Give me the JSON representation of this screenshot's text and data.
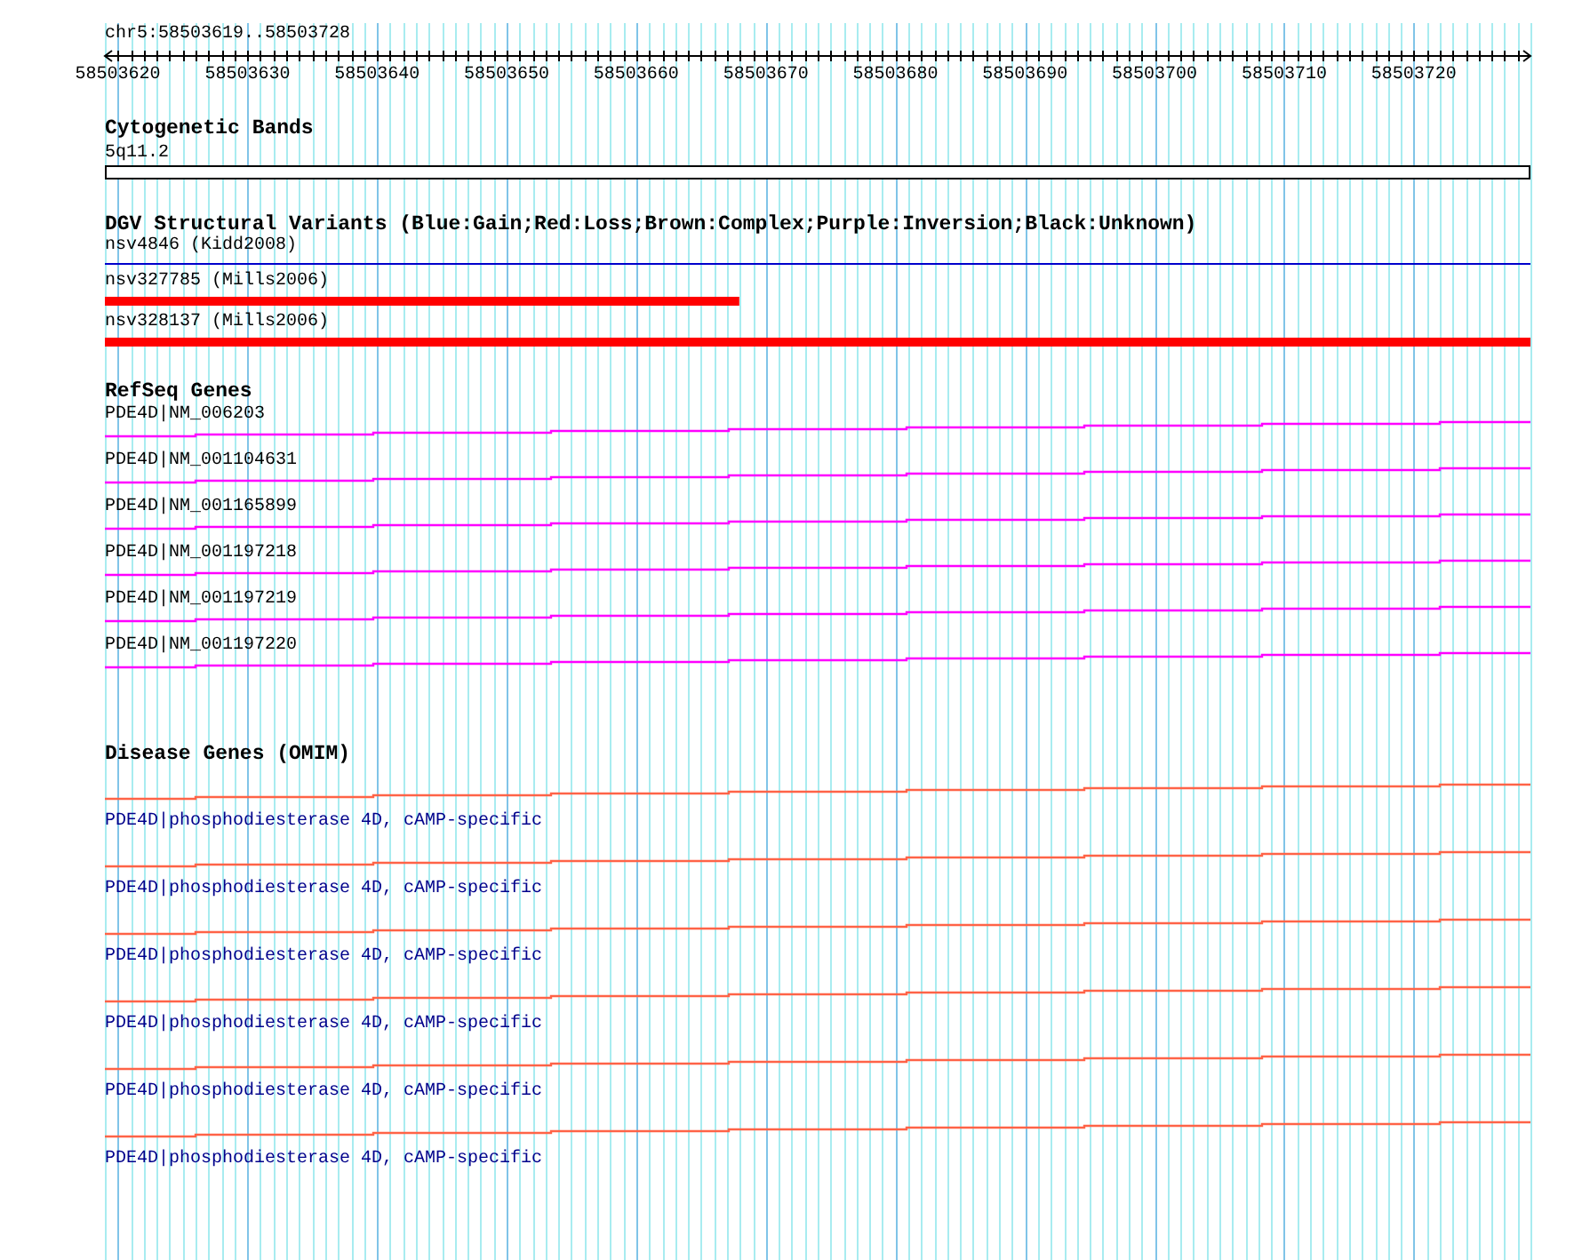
{
  "locus": "chr5:58503619..58503728",
  "ruler": {
    "ticks": [
      "58503620",
      "58503630",
      "58503640",
      "58503650",
      "58503660",
      "58503670",
      "58503680",
      "58503690",
      "58503700",
      "58503710",
      "58503720"
    ]
  },
  "tracks": [
    {
      "title": "Cytogenetic Bands",
      "kind": "bands",
      "features": [
        {
          "label": "5q11.2",
          "kind": "band"
        }
      ]
    },
    {
      "title": "DGV Structural Variants (Blue:Gain;Red:Loss;Brown:Complex;Purple:Inversion;Black:Unknown)",
      "kind": "variants",
      "features": [
        {
          "label": "nsv4846 (Kidd2008)",
          "kind": "line",
          "color": "#0000cc",
          "level": 1
        },
        {
          "label": "nsv327785 (Mills2006)",
          "kind": "bar",
          "color": "#ff0000",
          "level": 0.445
        },
        {
          "label": "nsv328137 (Mills2006)",
          "kind": "bar",
          "color": "#ff0000",
          "level": 1
        }
      ]
    },
    {
      "title": "RefSeq Genes",
      "kind": "genes",
      "features": [
        {
          "label": "PDE4D|NM_006203",
          "kind": "gene",
          "color": "#ff00ff"
        },
        {
          "label": "PDE4D|NM_001104631",
          "kind": "gene",
          "color": "#ff00ff"
        },
        {
          "label": "PDE4D|NM_001165899",
          "kind": "gene",
          "color": "#ff00ff"
        },
        {
          "label": "PDE4D|NM_001197218",
          "kind": "gene",
          "color": "#ff00ff"
        },
        {
          "label": "PDE4D|NM_001197219",
          "kind": "gene",
          "color": "#ff00ff"
        },
        {
          "label": "PDE4D|NM_001197220",
          "kind": "gene",
          "color": "#ff00ff"
        }
      ]
    },
    {
      "title": "Disease Genes (OMIM)",
      "kind": "omim",
      "features": [
        {
          "label": "PDE4D|phosphodiesterase 4D, cAMP-specific",
          "kind": "gene",
          "color": "#ff6347"
        },
        {
          "label": "PDE4D|phosphodiesterase 4D, cAMP-specific",
          "kind": "gene",
          "color": "#ff6347"
        },
        {
          "label": "PDE4D|phosphodiesterase 4D, cAMP-specific",
          "kind": "gene",
          "color": "#ff6347"
        },
        {
          "label": "PDE4D|phosphodiesterase 4D, cAMP-specific",
          "kind": "gene",
          "color": "#ff6347"
        },
        {
          "label": "PDE4D|phosphodiesterase 4D, cAMP-specific",
          "kind": "gene",
          "color": "#ff6347"
        },
        {
          "label": "PDE4D|phosphodiesterase 4D, cAMP-specific",
          "kind": "gene",
          "color": "#ff6347"
        }
      ]
    }
  ]
}
